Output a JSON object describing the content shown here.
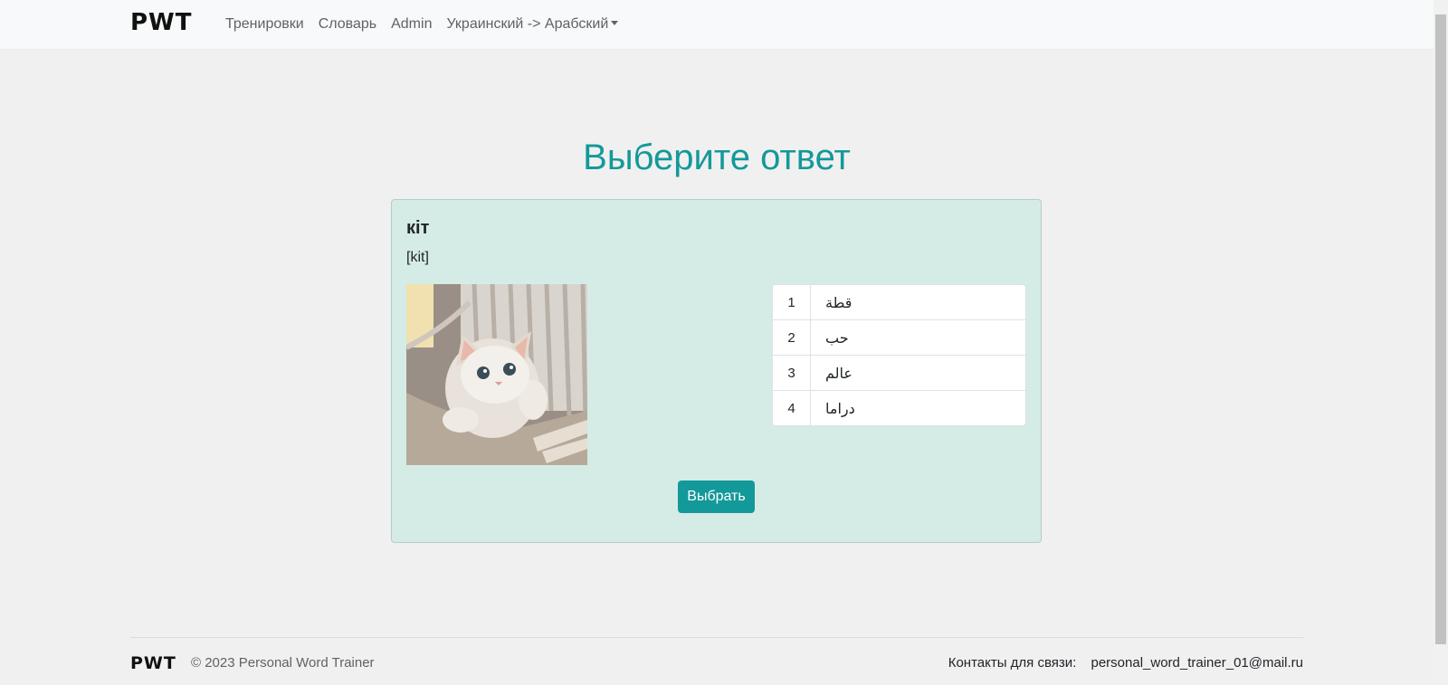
{
  "navbar": {
    "brand": "PWT",
    "items": [
      {
        "label": "Тренировки"
      },
      {
        "label": "Словарь"
      },
      {
        "label": "Admin"
      },
      {
        "label": "Украинский -> Арабский"
      }
    ]
  },
  "main": {
    "title": "Выберите ответ",
    "card": {
      "word": "кіт",
      "transcription": "[kit]",
      "image_icon": "cat-photo",
      "options": [
        {
          "num": "1",
          "text": "قطة"
        },
        {
          "num": "2",
          "text": "حب"
        },
        {
          "num": "3",
          "text": "عالم"
        },
        {
          "num": "4",
          "text": "دراما"
        }
      ],
      "submit_label": "Выбрать"
    }
  },
  "footer": {
    "brand": "PWT",
    "copyright": "© 2023 Personal Word Trainer",
    "contacts_label": "Контакты для связи:",
    "email": "personal_word_trainer_01@mail.ru"
  },
  "colors": {
    "accent": "#14999a",
    "card_bg": "#d5ebe6",
    "page_bg": "#f0f0f0"
  }
}
